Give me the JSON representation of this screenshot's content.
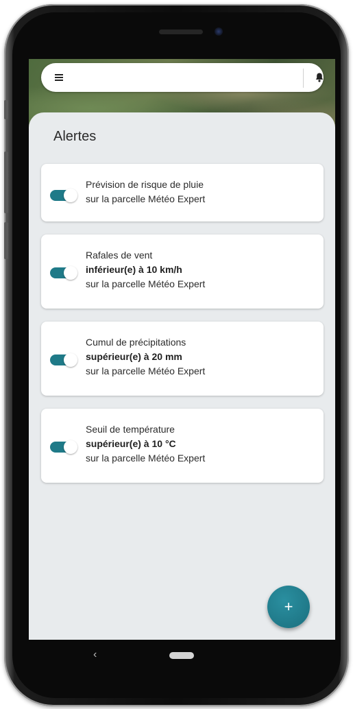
{
  "app": {
    "title": "Alertes"
  },
  "topbar": {
    "menu_icon": "menu-icon",
    "notification_icon": "bell-icon"
  },
  "colors": {
    "accent": "#1f7a88",
    "sheet_bg": "#e8ebed",
    "card_bg": "#ffffff"
  },
  "alerts": [
    {
      "enabled": true,
      "title": "Prévision de risque de pluie",
      "condition": "",
      "location": "sur la parcelle Météo Expert"
    },
    {
      "enabled": true,
      "title": "Rafales de vent",
      "condition": "inférieur(e) à 10 km/h",
      "location": "sur la parcelle Météo Expert"
    },
    {
      "enabled": true,
      "title": "Cumul de précipitations",
      "condition": "supérieur(e) à 20 mm",
      "location": "sur la parcelle Météo Expert"
    },
    {
      "enabled": true,
      "title": "Seuil de température",
      "condition": "supérieur(e) à 10 °C",
      "location": "sur la parcelle Météo Expert"
    }
  ],
  "fab": {
    "label": "+"
  },
  "navigation": {
    "back_glyph": "‹"
  }
}
